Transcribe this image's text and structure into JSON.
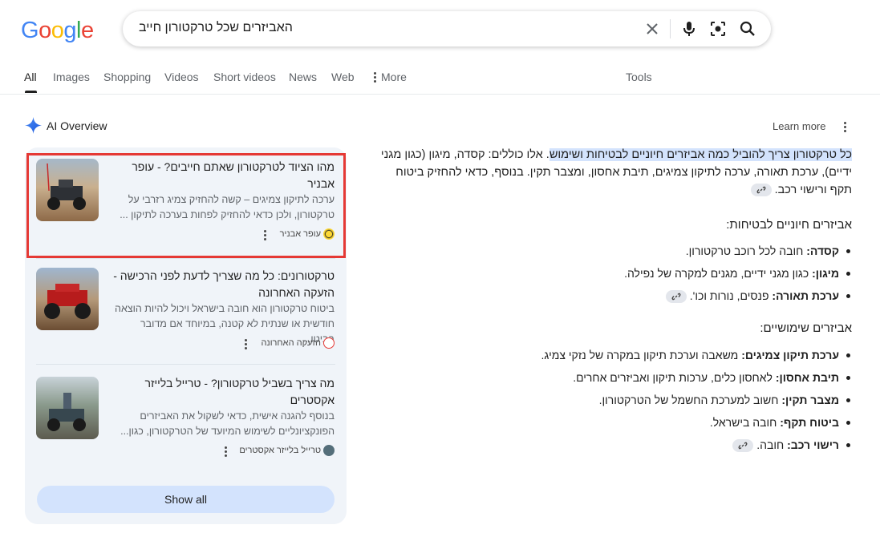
{
  "logo": {
    "letters": [
      "G",
      "o",
      "o",
      "g",
      "l",
      "e"
    ]
  },
  "search": {
    "query": "האביזרים שכל טרקטורון חייב"
  },
  "tabs": [
    {
      "label": "All"
    },
    {
      "label": "Images"
    },
    {
      "label": "Shopping"
    },
    {
      "label": "Videos"
    },
    {
      "label": "Short videos"
    },
    {
      "label": "News"
    },
    {
      "label": "Web"
    },
    {
      "label": "More"
    }
  ],
  "tools_label": "Tools",
  "ai_overview": {
    "title": "AI Overview",
    "learn_more": "Learn more"
  },
  "cards": [
    {
      "title": "מהו הציוד לטרקטורון שאתם חייבים? - עופר אבניר",
      "snippet": "ערכה לתיקון צמיגים – קשה להחזיק צמיג רזרבי על טרקטורון, ולכן כדאי להחזיק לפחות בערכה לתיקון ...",
      "source": "עופר אבניר"
    },
    {
      "title": "טרקטורונים: כל מה שצריך לדעת לפני הרכישה - הזעקה האחרונה",
      "snippet": "ביטוח טרקטורון הוא חובה בישראל ויכול להיות הוצאה חודשית או שנתית לא קטנה, במיוחד אם מדובר בביטו...",
      "source": "הזעקה האחרונה"
    },
    {
      "title": "מה צריך בשביל טרקטורון? - טרייל בלייזר אקסטרים",
      "snippet": "בנוסף להגנה אישית, כדאי לשקול את האביזרים הפונקציונליים לשימוש המיועד של הטרקטורון, כגון...",
      "source": "טרייל בלייזר אקסטרים"
    }
  ],
  "show_all": "Show all",
  "answer": {
    "intro_highlight": "כל טרקטורון צריך להוביל כמה אביזרים חיוניים לבטיחות ושימוש",
    "intro_rest": ". אלו כוללים: קסדה, מיגון (כגון מגני ידיים), ערכת תאורה, ערכה לתיקון צמיגים, תיבת אחסון, ומצבר תקין. בנוסף, כדאי להחזיק ביטוח תקף ורישוי רכב.",
    "section1_title": "אביזרים חיוניים לבטיחות:",
    "section1": [
      {
        "term": "קסדה:",
        "text": "חובה לכל רוכב טרקטורון."
      },
      {
        "term": "מיגון:",
        "text": "כגון מגני ידיים, מגנים למקרה של נפילה."
      },
      {
        "term": "ערכת תאורה:",
        "text": "פנסים, נורות וכו'."
      }
    ],
    "section2_title": "אביזרים שימושיים:",
    "section2": [
      {
        "term": "ערכת תיקון צמיגים:",
        "text": "משאבה וערכת תיקון במקרה של נזקי צמיג."
      },
      {
        "term": "תיבת אחסון:",
        "text": "לאחסון כלים, ערכות תיקון ואביזרים אחרים."
      },
      {
        "term": "מצבר תקין:",
        "text": "חשוב למערכת החשמל של הטרקטורון."
      },
      {
        "term": "ביטוח תקף:",
        "text": "חובה בישראל."
      },
      {
        "term": "רישוי רכב:",
        "text": "חובה."
      }
    ]
  }
}
